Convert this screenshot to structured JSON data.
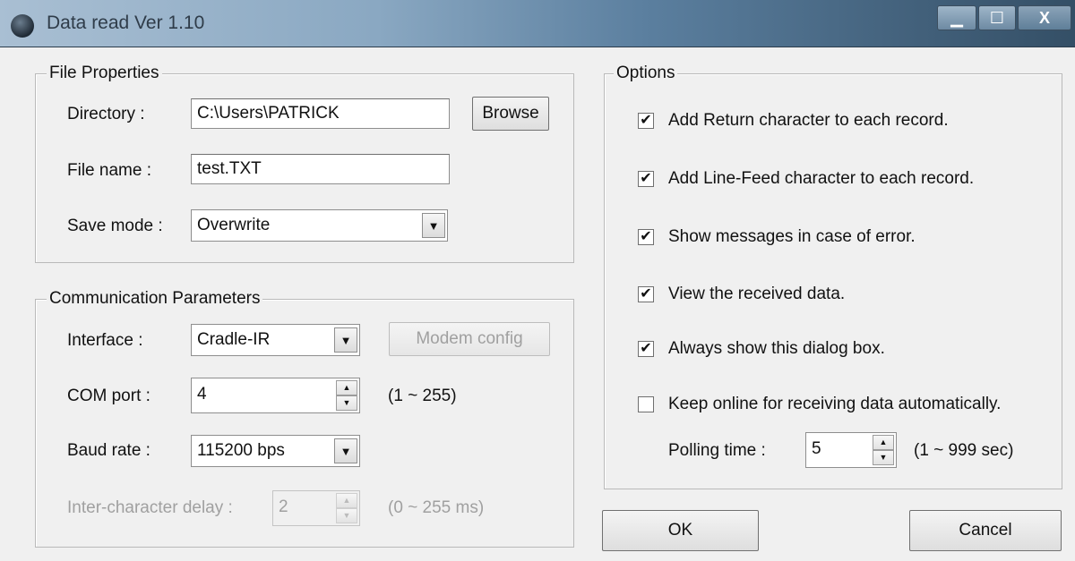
{
  "window": {
    "title": "Data read  Ver 1.10",
    "minimize_glyph": "▁",
    "maximize_glyph": "☐",
    "close_glyph": "X"
  },
  "file_properties": {
    "legend": "File Properties",
    "directory_label": "Directory :",
    "directory_value": "C:\\Users\\PATRICK",
    "browse_label": "Browse",
    "filename_label": "File name :",
    "filename_value": "test.TXT",
    "savemode_label": "Save mode :",
    "savemode_value": "Overwrite"
  },
  "communication": {
    "legend": "Communication Parameters",
    "interface_label": "Interface :",
    "interface_value": "Cradle-IR",
    "modem_config_label": "Modem config",
    "comport_label": "COM port :",
    "comport_value": "4",
    "comport_range": "(1 ~ 255)",
    "baudrate_label": "Baud rate :",
    "baudrate_value": "115200 bps",
    "delay_label": "Inter-character delay :",
    "delay_value": "2",
    "delay_range": "(0 ~ 255 ms)"
  },
  "options": {
    "legend": "Options",
    "items": [
      {
        "label": "Add Return character to each record.",
        "checked": true
      },
      {
        "label": "Add Line-Feed character to each record.",
        "checked": true
      },
      {
        "label": "Show messages in case of error.",
        "checked": true
      },
      {
        "label": "View the received data.",
        "checked": true
      },
      {
        "label": "Always show this dialog box.",
        "checked": true
      },
      {
        "label": "Keep online for receiving data automatically.",
        "checked": false
      }
    ],
    "polling_label": "Polling time :",
    "polling_value": "5",
    "polling_range": "(1 ~ 999 sec)"
  },
  "buttons": {
    "ok_label": "OK",
    "cancel_label": "Cancel"
  },
  "glyphs": {
    "check": "✔",
    "dropdown": "▼",
    "spin_up": "▲",
    "spin_down": "▼"
  }
}
